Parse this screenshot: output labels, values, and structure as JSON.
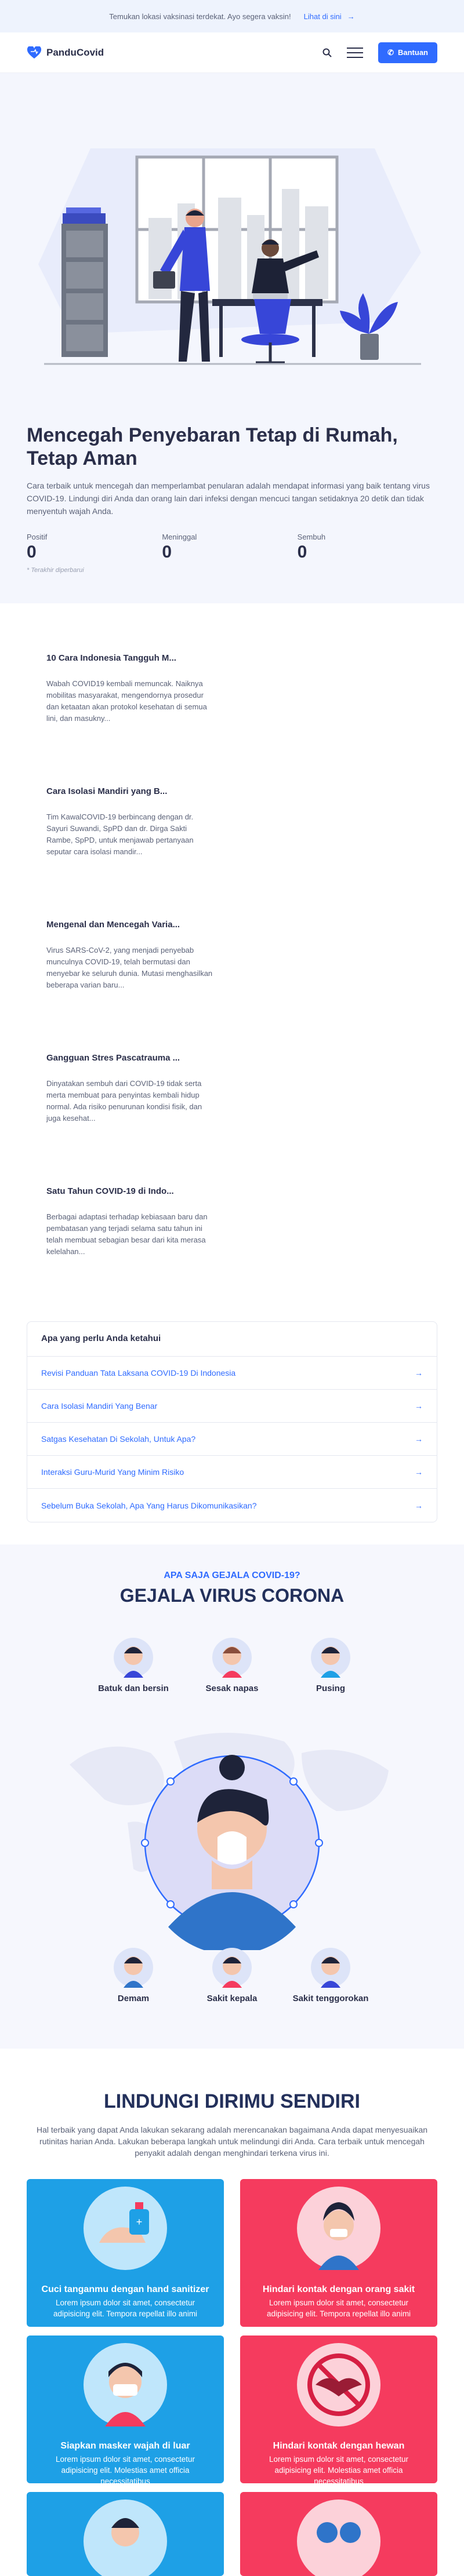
{
  "topbar": {
    "text": "Temukan lokasi vaksinasi terdekat. Ayo segera vaksin!",
    "link": "Lihat di sini"
  },
  "nav": {
    "brand": "PanduCovid",
    "help": "Bantuan"
  },
  "hero": {
    "title": "Mencegah Penyebaran Tetap di Rumah, Tetap Aman",
    "desc": "Cara terbaik untuk mencegah dan memperlambat penularan adalah mendapat informasi yang baik tentang virus COVID-19. Lindungi diri Anda dan orang lain dari infeksi dengan mencuci tangan setidaknya 20 detik dan tidak menyentuh wajah Anda.",
    "stats": [
      {
        "label": "Positif",
        "value": "0"
      },
      {
        "label": "Meninggal",
        "value": "0"
      },
      {
        "label": "Sembuh",
        "value": "0"
      }
    ],
    "note": "* Terakhir diperbarui"
  },
  "news": [
    {
      "title": "10 Cara Indonesia Tangguh M...",
      "excerpt": "Wabah COVID19 kembali memuncak. Naiknya mobilitas masyarakat, mengendornya prosedur dan ketaatan akan protokol kesehatan di semua lini, dan masukny..."
    },
    {
      "title": "Cara Isolasi Mandiri yang B...",
      "excerpt": "Tim KawalCOVID-19 berbincang dengan dr. Sayuri Suwandi, SpPD dan dr. Dirga Sakti Rambe, SpPD, untuk menjawab pertanyaan seputar cara isolasi mandir..."
    },
    {
      "title": "Mengenal dan Mencegah Varia...",
      "excerpt": "Virus SARS-CoV-2, yang menjadi penyebab munculnya COVID-19, telah bermutasi dan menyebar ke seluruh dunia. Mutasi menghasilkan beberapa varian baru..."
    },
    {
      "title": "Gangguan Stres Pascatrauma ...",
      "excerpt": "Dinyatakan sembuh dari COVID-19 tidak serta merta membuat para penyintas kembali hidup normal. Ada risiko penurunan kondisi fisik, dan juga kesehat..."
    },
    {
      "title": "Satu Tahun COVID-19 di Indo...",
      "excerpt": "Berbagai adaptasi terhadap kebiasaan baru dan pembatasan yang terjadi selama satu tahun ini telah membuat sebagian besar dari kita merasa kelelahan..."
    }
  ],
  "faq": {
    "title": "Apa yang perlu Anda ketahui",
    "items": [
      "Revisi Panduan Tata Laksana COVID-19 Di Indonesia",
      "Cara Isolasi Mandiri Yang Benar",
      "Satgas Kesehatan Di Sekolah, Untuk Apa?",
      "Interaksi Guru-Murid Yang Minim Risiko",
      "Sebelum Buka Sekolah, Apa Yang Harus Dikomunikasikan?"
    ]
  },
  "symptoms": {
    "subtitle": "APA SAJA GEJALA COVID-19?",
    "title": "GEJALA VIRUS CORONA",
    "items": [
      "Batuk dan bersin",
      "Sesak napas",
      "Pusing",
      "Demam",
      "Sakit kepala",
      "Sakit tenggorokan"
    ]
  },
  "protect": {
    "title": "LINDUNGI DIRIMU SENDIRI",
    "desc": "Hal terbaik yang dapat Anda lakukan sekarang adalah merencanakan bagaimana Anda dapat menyesuaikan rutinitas harian Anda. Lakukan beberapa langkah untuk melindungi diri Anda. Cara terbaik untuk mencegah penyakit adalah dengan menghindari terkena virus ini.",
    "cards": [
      {
        "title": "Cuci tanganmu dengan hand sanitizer",
        "text": "Lorem ipsum dolor sit amet, consectetur adipisicing elit. Tempora repellat illo animi",
        "color": "#1ea0e6"
      },
      {
        "title": "Hindari kontak dengan orang sakit",
        "text": "Lorem ipsum dolor sit amet, consectetur adipisicing elit. Tempora repellat illo animi",
        "color": "#f53b5e"
      },
      {
        "title": "Siapkan masker wajah di luar",
        "text": "Lorem ipsum dolor sit amet, consectetur adipisicing elit. Molestias amet officia necessitatibus",
        "color": "#1ea0e6"
      },
      {
        "title": "Hindari kontak dengan hewan",
        "text": "Lorem ipsum dolor sit amet, consectetur adipisicing elit. Molestias amet officia necessitatibus",
        "color": "#f53b5e"
      }
    ]
  }
}
